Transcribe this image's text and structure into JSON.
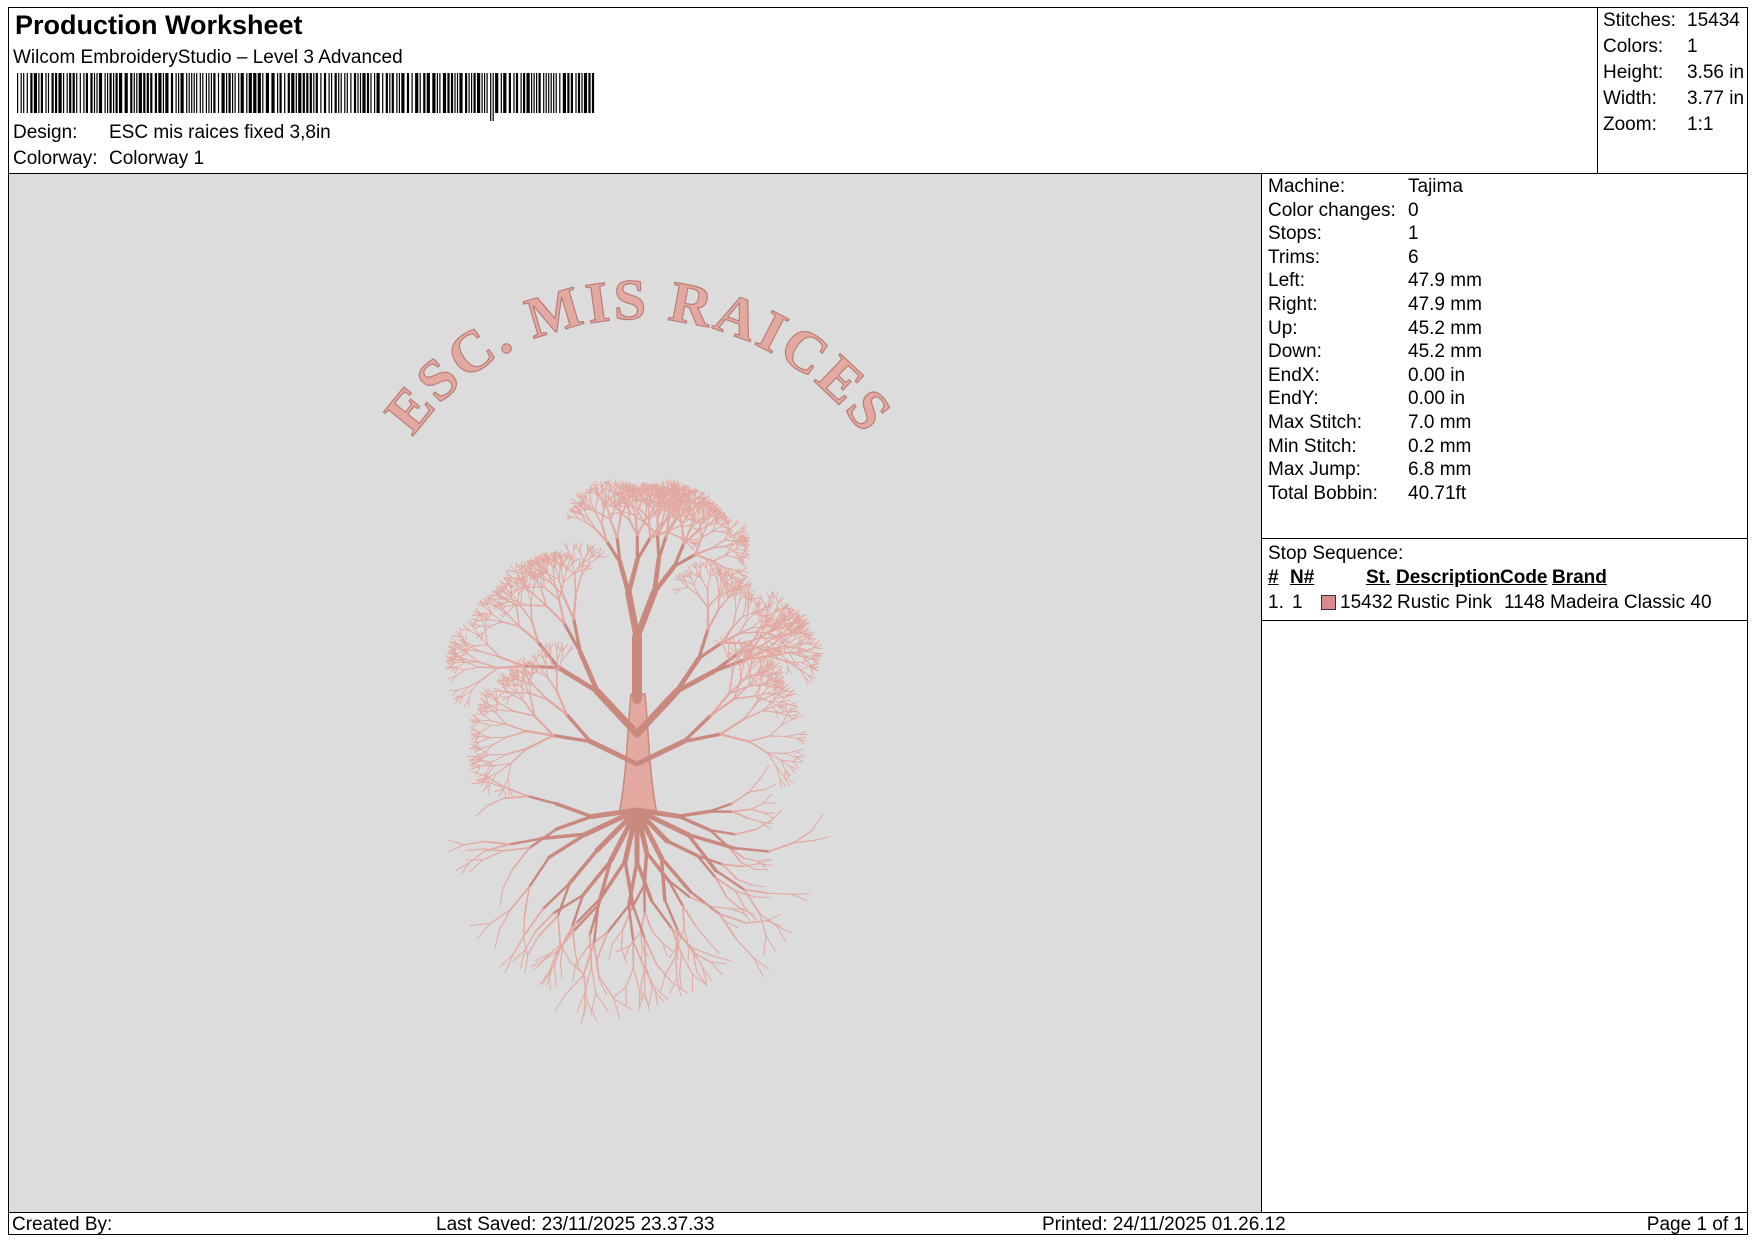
{
  "header": {
    "title": "Production Worksheet",
    "subtitle": "Wilcom EmbroideryStudio – Level 3 Advanced",
    "design_label": "Design:",
    "design_value": "ESC mis raices fixed 3,8in",
    "colorway_label": "Colorway:",
    "colorway_value": "Colorway 1"
  },
  "summary": [
    {
      "label": "Stitches:",
      "value": "15434"
    },
    {
      "label": "Colors:",
      "value": "1"
    },
    {
      "label": "Height:",
      "value": "3.56 in"
    },
    {
      "label": "Width:",
      "value": "3.77 in"
    },
    {
      "label": "Zoom:",
      "value": "1:1"
    }
  ],
  "preview": {
    "design_text": "ESC. MIS RAICES",
    "thread_color": "#e3a9a0",
    "background_color": "#dcdcdc"
  },
  "machine_info": [
    {
      "label": "Machine:",
      "value": "Tajima"
    },
    {
      "label": "Color changes:",
      "value": "0"
    },
    {
      "label": "Stops:",
      "value": "1"
    },
    {
      "label": "Trims:",
      "value": "6"
    },
    {
      "label": "Left:",
      "value": "47.9 mm"
    },
    {
      "label": "Right:",
      "value": "47.9 mm"
    },
    {
      "label": "Up:",
      "value": "45.2 mm"
    },
    {
      "label": "Down:",
      "value": "45.2 mm"
    },
    {
      "label": "EndX:",
      "value": "0.00 in"
    },
    {
      "label": "EndY:",
      "value": "0.00 in"
    },
    {
      "label": "Max Stitch:",
      "value": "7.0 mm"
    },
    {
      "label": "Min Stitch:",
      "value": "0.2 mm"
    },
    {
      "label": "Max Jump:",
      "value": "6.8 mm"
    },
    {
      "label": "Total Bobbin:",
      "value": "40.71ft"
    }
  ],
  "stop_sequence": {
    "title": "Stop Sequence:",
    "headers": {
      "num": "#",
      "needle": "N#",
      "stitches": "St.",
      "description": "Description",
      "code": "Code",
      "brand": "Brand"
    },
    "rows": [
      {
        "num": "1.",
        "needle": "1",
        "swatch_color": "#d98a8f",
        "stitches": "15432",
        "description": "Rustic Pink",
        "code": "1148",
        "brand": "Madeira Classic 40"
      }
    ]
  },
  "footer": {
    "created_by": "Created By:",
    "last_saved": "Last Saved: 23/11/2025 23.37.33",
    "printed": "Printed: 24/11/2025 01.26.12",
    "page": "Page 1 of 1"
  }
}
